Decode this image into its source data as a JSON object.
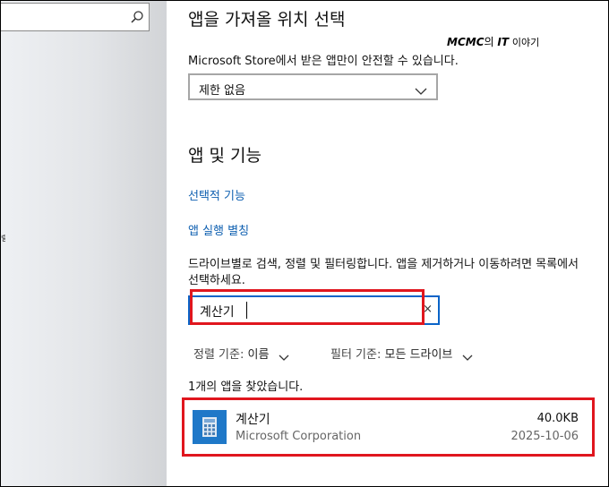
{
  "sidebar": {
    "search_placeholder": "",
    "edge_glyph": "렬"
  },
  "main": {
    "source_heading": "앱을 가져올 위치 선택",
    "source_description": "Microsoft Store에서 받은 앱만이 안전할 수 있습니다.",
    "source_dropdown": {
      "selected": "제한 없음"
    },
    "apps_heading": "앱 및 기능",
    "links": {
      "optional_features": "선택적 기능",
      "app_aliases": "앱 실행 별칭"
    },
    "search_description": "드라이브별로 검색, 정렬 및 필터링합니다. 앱을 제거하거나 이동하려면 목록에서 선택하세요.",
    "app_search": {
      "value": "계산기",
      "clear_symbol": "×"
    },
    "sort": {
      "label": "정렬 기준:",
      "value": "이름"
    },
    "filter": {
      "label": "필터 기준:",
      "value": "모든 드라이브"
    },
    "result_count": "1개의 앱을 찾았습니다.",
    "apps": [
      {
        "name": "계산기",
        "publisher": "Microsoft Corporation",
        "size": "40.0KB",
        "date": "2025-10-06"
      }
    ]
  },
  "watermark": {
    "brand": "MCMC",
    "particle": "의",
    "it": "IT",
    "suffix": "이야기"
  },
  "colors": {
    "link": "#0e5fb0",
    "highlight": "#e0161e",
    "focus_border": "#0a64c8",
    "app_icon": "#1f78c8"
  }
}
